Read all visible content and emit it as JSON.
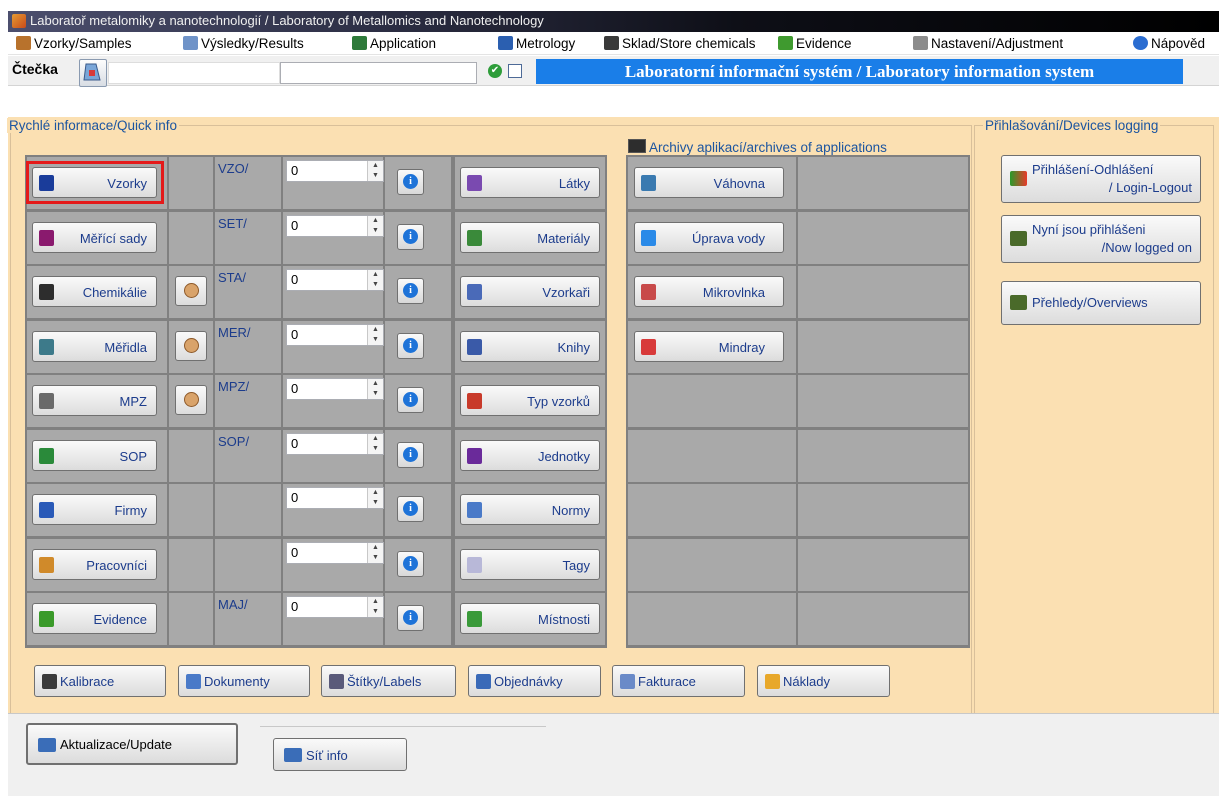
{
  "window": {
    "title": "Laboratoř metalomiky a nanotechnologií / Laboratory of Metallomics and Nanotechnology"
  },
  "menu": {
    "items": [
      {
        "label": "Vzorky/Samples",
        "icon": "samples-icon",
        "color": "#b8722c"
      },
      {
        "label": "Výsledky/Results",
        "icon": "results-icon",
        "color": "#6f93c8"
      },
      {
        "label": "Application",
        "icon": "application-icon",
        "color": "#2e7a3a"
      },
      {
        "label": "Metrology",
        "icon": "metrology-icon",
        "color": "#2b5fb0"
      },
      {
        "label": "Sklad/Store chemicals",
        "icon": "chemicals-icon",
        "color": "#3a3a3a"
      },
      {
        "label": "Evidence",
        "icon": "evidence-icon",
        "color": "#3f9a2f"
      },
      {
        "label": "Nastavení/Adjustment",
        "icon": "wrench-icon",
        "color": "#8c8c8c"
      },
      {
        "label": "Nápověd",
        "icon": "help-icon",
        "color": "#2b6dd1"
      }
    ]
  },
  "toolbar": {
    "reader_label": "Čtečka",
    "banner": "Laboratorní informační systém / Laboratory information system",
    "status_icon": "check-circle-icon"
  },
  "quick_info": {
    "title": "Rychlé informace/Quick info",
    "rows": [
      {
        "button": "Vzorky",
        "icon": "tubes-icon",
        "prefix": "VZO/",
        "value": "0",
        "store": false,
        "color": "#1a3c9a"
      },
      {
        "button": "Měřící sady",
        "icon": "test-rack-icon",
        "prefix": "SET/",
        "value": "0",
        "store": false,
        "color": "#8a1a6e"
      },
      {
        "button": "Chemikálie",
        "icon": "chemical-bottle-icon",
        "prefix": "STA/",
        "value": "0",
        "store": true,
        "color": "#2d2d2d"
      },
      {
        "button": "Měřidla",
        "icon": "gauge-icon",
        "prefix": "MER/",
        "value": "0",
        "store": true,
        "color": "#3d7a8a"
      },
      {
        "button": "MPZ",
        "icon": "flask-icon",
        "prefix": "MPZ/",
        "value": "0",
        "store": true,
        "color": "#6a6a6a"
      },
      {
        "button": "SOP",
        "icon": "beaker-icon",
        "prefix": "SOP/",
        "value": "0",
        "store": false,
        "color": "#2a8a3a"
      },
      {
        "button": "Firmy",
        "icon": "book-icon",
        "prefix": "",
        "value": "0",
        "store": false,
        "color": "#2a5ab8"
      },
      {
        "button": "Pracovníci",
        "icon": "users-icon",
        "prefix": "",
        "value": "0",
        "store": false,
        "color": "#d08a2a"
      },
      {
        "button": "Evidence",
        "icon": "evidence-book-icon",
        "prefix": "MAJ/",
        "value": "0",
        "store": false,
        "color": "#3a9a2a"
      }
    ],
    "catalogs": [
      {
        "button": "Látky",
        "icon": "elements-icon",
        "color": "#7a4ab0"
      },
      {
        "button": "Materiály",
        "icon": "material-icon",
        "color": "#3a8a3a"
      },
      {
        "button": "Vzorkaři",
        "icon": "sampler-icon",
        "color": "#4a6ab8"
      },
      {
        "button": "Knihy",
        "icon": "books-icon",
        "color": "#3a5aa8"
      },
      {
        "button": "Typ vzorků",
        "icon": "chart-bars-icon",
        "color": "#c83a2a"
      },
      {
        "button": "Jednotky",
        "icon": "mol-units-icon",
        "color": "#6a2a9a"
      },
      {
        "button": "Normy",
        "icon": "document-icon",
        "color": "#4a7ac8"
      },
      {
        "button": "Tagy",
        "icon": "tag-icon",
        "color": "#b8b8d8"
      },
      {
        "button": "Místnosti",
        "icon": "home-icon",
        "color": "#3a9a3a"
      }
    ],
    "archives_title": "Archivy aplikací/archives of applications",
    "archives": [
      {
        "button": "Váhovna",
        "icon": "scale-icon",
        "color": "#3a7ab0"
      },
      {
        "button": "Úprava vody",
        "icon": "water-drop-icon",
        "color": "#2a8ae8"
      },
      {
        "button": "Mikrovlnka",
        "icon": "microwave-icon",
        "color": "#c84a4a"
      },
      {
        "button": "Mindray",
        "icon": "mindray-icon",
        "color": "#d83a3a"
      }
    ],
    "bottom_buttons": [
      {
        "label": "Kalibrace",
        "icon": "calibration-icon",
        "color": "#3a3a3a"
      },
      {
        "label": "Dokumenty",
        "icon": "documents-icon",
        "color": "#4a7ac8"
      },
      {
        "label": "Štítky/Labels",
        "icon": "labels-icon",
        "color": "#5a5a7a"
      },
      {
        "label": "Objednávky",
        "icon": "orders-icon",
        "color": "#3a6ab8"
      },
      {
        "label": "Fakturace",
        "icon": "invoice-icon",
        "color": "#6a8ac8"
      },
      {
        "label": "Náklady",
        "icon": "costs-icon",
        "color": "#e8a82a"
      }
    ]
  },
  "devices": {
    "title": "Přihlašování/Devices logging",
    "buttons": [
      {
        "label": "Přihlášení-Odhlášení / Login-Logout",
        "line1": "Přihlášení-Odhlášení",
        "line2": "/ Login-Logout",
        "icon": "login-arrows-icon"
      },
      {
        "label": "Nyní jsou přihlášeni /Now logged on",
        "line1": "Nyní jsou přihlášeni",
        "line2": "/Now logged on",
        "icon": "logged-on-icon"
      },
      {
        "label": "Přehledy/Overviews",
        "line1": "Přehledy/Overviews",
        "line2": "",
        "icon": "overviews-icon"
      }
    ]
  },
  "footer": {
    "update_label": "Aktualizace/Update",
    "network_label": "Síť info"
  }
}
